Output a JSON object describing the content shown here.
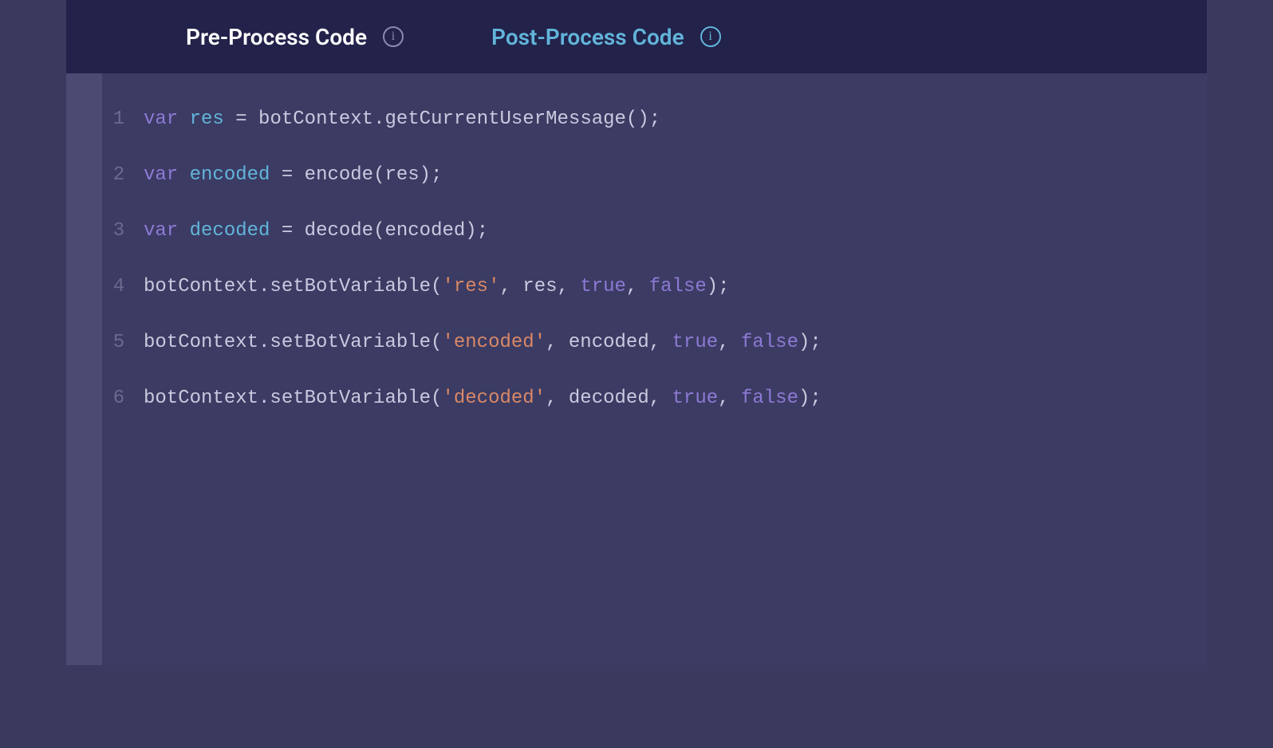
{
  "tabs": {
    "preprocess_label": "Pre-Process Code",
    "postprocess_label": "Post-Process Code",
    "active": "preprocess"
  },
  "code": {
    "lines": [
      {
        "num": "1",
        "tokens": [
          {
            "t": "var",
            "c": "keyword"
          },
          {
            "t": " ",
            "c": "default"
          },
          {
            "t": "res",
            "c": "ident"
          },
          {
            "t": " = botContext.getCurrentUserMessage();",
            "c": "default"
          }
        ]
      },
      {
        "num": "2",
        "tokens": [
          {
            "t": "var",
            "c": "keyword"
          },
          {
            "t": " ",
            "c": "default"
          },
          {
            "t": "encoded",
            "c": "ident"
          },
          {
            "t": " = encode(res);",
            "c": "default"
          }
        ]
      },
      {
        "num": "3",
        "tokens": [
          {
            "t": "var",
            "c": "keyword"
          },
          {
            "t": " ",
            "c": "default"
          },
          {
            "t": "decoded",
            "c": "ident"
          },
          {
            "t": " = decode(encoded);",
            "c": "default"
          }
        ]
      },
      {
        "num": "4",
        "tokens": [
          {
            "t": "botContext.setBotVariable(",
            "c": "default"
          },
          {
            "t": "'res'",
            "c": "string"
          },
          {
            "t": ", res, ",
            "c": "default"
          },
          {
            "t": "true",
            "c": "bool"
          },
          {
            "t": ", ",
            "c": "default"
          },
          {
            "t": "false",
            "c": "bool"
          },
          {
            "t": ");",
            "c": "default"
          }
        ]
      },
      {
        "num": "5",
        "tokens": [
          {
            "t": "botContext.setBotVariable(",
            "c": "default"
          },
          {
            "t": "'encoded'",
            "c": "string"
          },
          {
            "t": ", encoded, ",
            "c": "default"
          },
          {
            "t": "true",
            "c": "bool"
          },
          {
            "t": ", ",
            "c": "default"
          },
          {
            "t": "false",
            "c": "bool"
          },
          {
            "t": ");",
            "c": "default"
          }
        ]
      },
      {
        "num": "6",
        "tokens": [
          {
            "t": "botContext.setBotVariable(",
            "c": "default"
          },
          {
            "t": "'decoded'",
            "c": "string"
          },
          {
            "t": ", decoded, ",
            "c": "default"
          },
          {
            "t": "true",
            "c": "bool"
          },
          {
            "t": ", ",
            "c": "default"
          },
          {
            "t": "false",
            "c": "bool"
          },
          {
            "t": ");",
            "c": "default"
          }
        ]
      }
    ]
  }
}
